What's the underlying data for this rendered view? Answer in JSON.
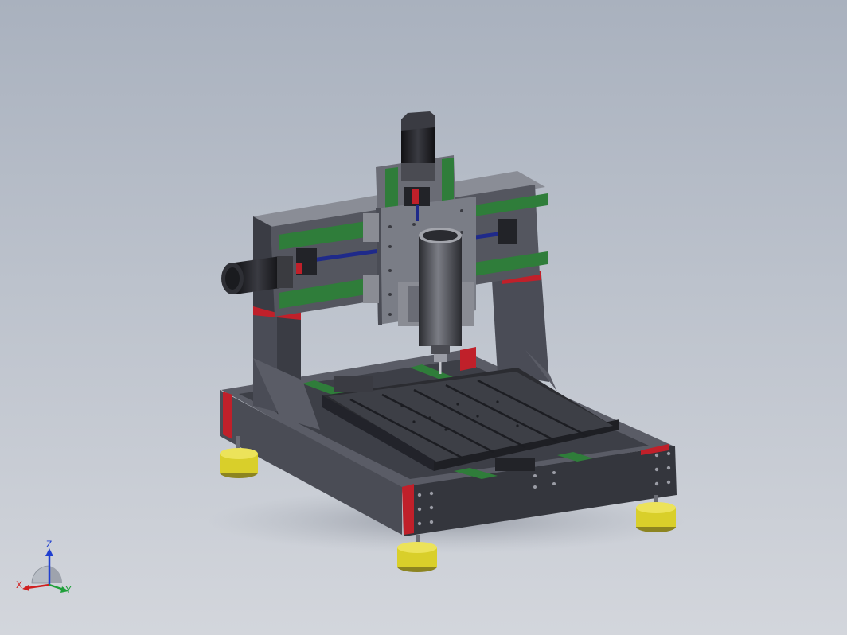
{
  "viewport": {
    "background_top": "#a9b1be",
    "background_bottom": "#d3d6dc"
  },
  "triad": {
    "z_label": "Z",
    "x_label": "X",
    "y_label": "Y",
    "z_color": "#1f3fd0",
    "x_color": "#d01f1f",
    "y_color": "#1fa03a"
  },
  "model": {
    "frame_color": "#3f4048",
    "rail_color": "#2f7d3a",
    "accent_color": "#c0202a",
    "foot_color": "#d9cf2a",
    "motor_color": "#1e1e22"
  }
}
